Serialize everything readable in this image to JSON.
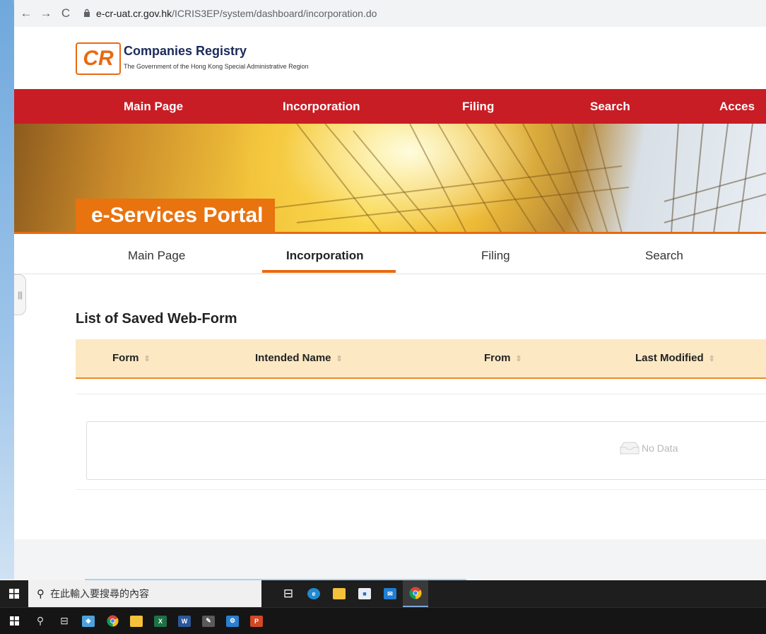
{
  "browser": {
    "back_icon": "←",
    "forward_icon": "→",
    "reload_icon": "C",
    "lock_icon": "lock",
    "url_host": "e-cr-uat.cr.gov.hk",
    "url_path": "/ICRIS3EP/system/dashboard/incorporation.do"
  },
  "header": {
    "logo_text": "CR",
    "title": "Companies Registry",
    "subtitle": "The Government of the Hong Kong Special Administrative Region"
  },
  "main_nav": {
    "items": [
      "Main Page",
      "Incorporation",
      "Filing",
      "Search",
      "Acces"
    ]
  },
  "banner": {
    "portal_title": "e-Services Portal"
  },
  "sub_tabs": {
    "items": [
      "Main Page",
      "Incorporation",
      "Filing",
      "Search"
    ],
    "active": "Incorporation"
  },
  "section": {
    "title": "List of Saved Web-Form",
    "columns": [
      "Form",
      "Intended Name",
      "From",
      "Last Modified"
    ],
    "sort_glyph": "⇕",
    "empty_text": "No Data"
  },
  "taskbar": {
    "search_placeholder": "在此輸入要搜尋的內容"
  },
  "colors": {
    "nav_red": "#c81d25",
    "accent_orange": "#e86a10",
    "table_header": "#fde8c4"
  }
}
